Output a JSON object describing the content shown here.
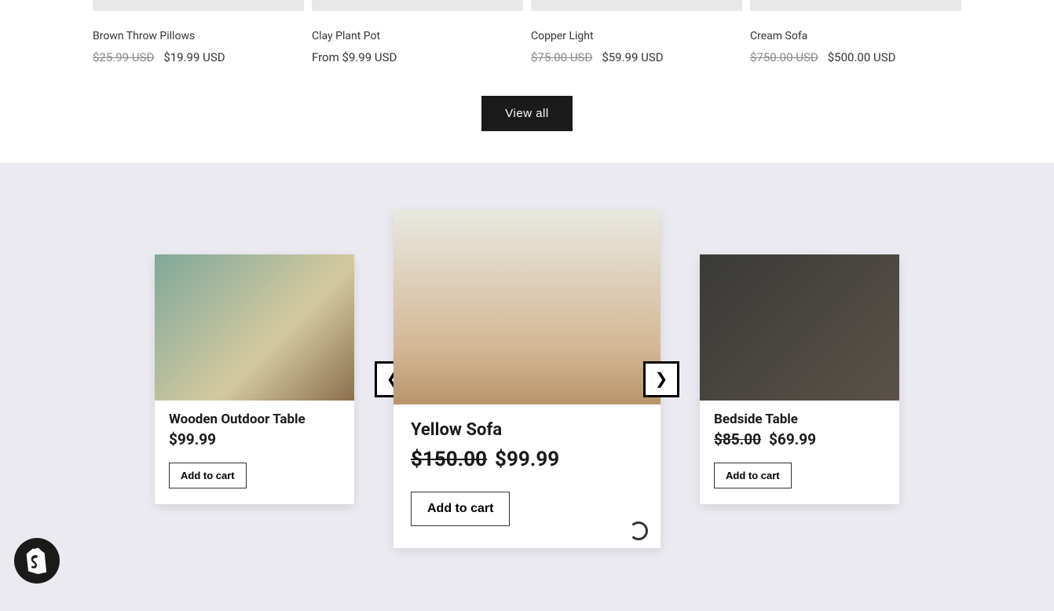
{
  "topProducts": [
    {
      "title": "Brown Throw Pillows",
      "oldPrice": "$25.99 USD",
      "newPrice": "$19.99 USD"
    },
    {
      "title": "Clay Plant Pot",
      "oldPrice": "",
      "newPrice": "From $9.99 USD"
    },
    {
      "title": "Copper Light",
      "oldPrice": "$75.00 USD",
      "newPrice": "$59.99 USD"
    },
    {
      "title": "Cream Sofa",
      "oldPrice": "$750.00 USD",
      "newPrice": "$500.00 USD"
    }
  ],
  "viewAll": "View all",
  "carousel": {
    "left": {
      "title": "Wooden Outdoor Table",
      "price": "$99.99",
      "button": "Add to cart"
    },
    "center": {
      "title": "Yellow Sofa",
      "oldPrice": "$150.00",
      "newPrice": "$99.99",
      "button": "Add to cart"
    },
    "right": {
      "title": "Bedside Table",
      "oldPrice": "$85.00",
      "newPrice": "$69.99",
      "button": "Add to cart"
    }
  }
}
